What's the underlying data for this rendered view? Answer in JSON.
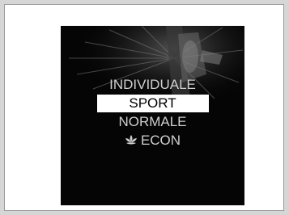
{
  "drive_mode_menu": {
    "items": [
      {
        "label": "INDIVIDUALE",
        "selected": false
      },
      {
        "label": "SPORT",
        "selected": true
      },
      {
        "label": "NORMALE",
        "selected": false
      },
      {
        "label": "ECON",
        "selected": false,
        "icon": "eco-leaf-icon"
      }
    ]
  },
  "colors": {
    "screen_background": "#050505",
    "selected_background": "#ffffff",
    "selected_text": "#000000",
    "item_text": "#cfcfcf"
  }
}
